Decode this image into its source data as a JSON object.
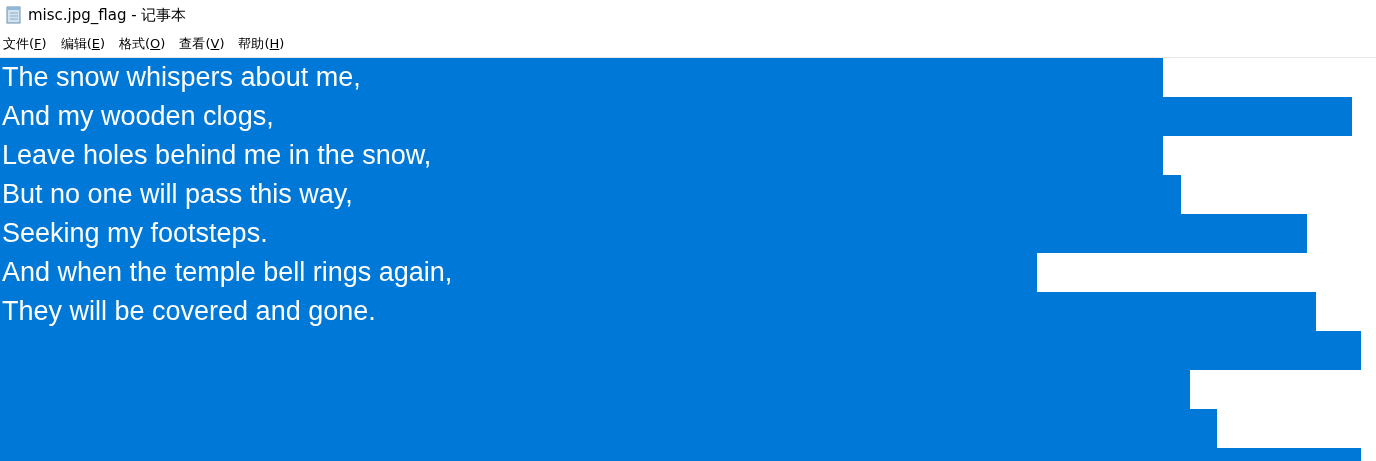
{
  "window": {
    "title": "misc.jpg_flag - 记事本"
  },
  "menu": [
    {
      "label": "文件(F)"
    },
    {
      "label": "编辑(E)"
    },
    {
      "label": "格式(O)"
    },
    {
      "label": "查看(V)"
    },
    {
      "label": "帮助(H)"
    }
  ],
  "editor": {
    "lines": [
      {
        "text": "The snow whispers about me,",
        "selected": true
      },
      {
        "text": "And my wooden clogs,",
        "selected": true
      },
      {
        "text": "Leave holes behind me in the snow,",
        "selected": true
      },
      {
        "text": "But no one will pass this way,",
        "selected": true
      },
      {
        "text": "Seeking my footsteps.",
        "selected": true
      },
      {
        "text": "And when the temple bell rings again,",
        "selected": true
      },
      {
        "text": "They will be covered and gone.",
        "selected": true
      },
      {
        "selected": true
      },
      {
        "selected": true
      },
      {
        "selected": true
      },
      {
        "selected": true
      }
    ]
  }
}
